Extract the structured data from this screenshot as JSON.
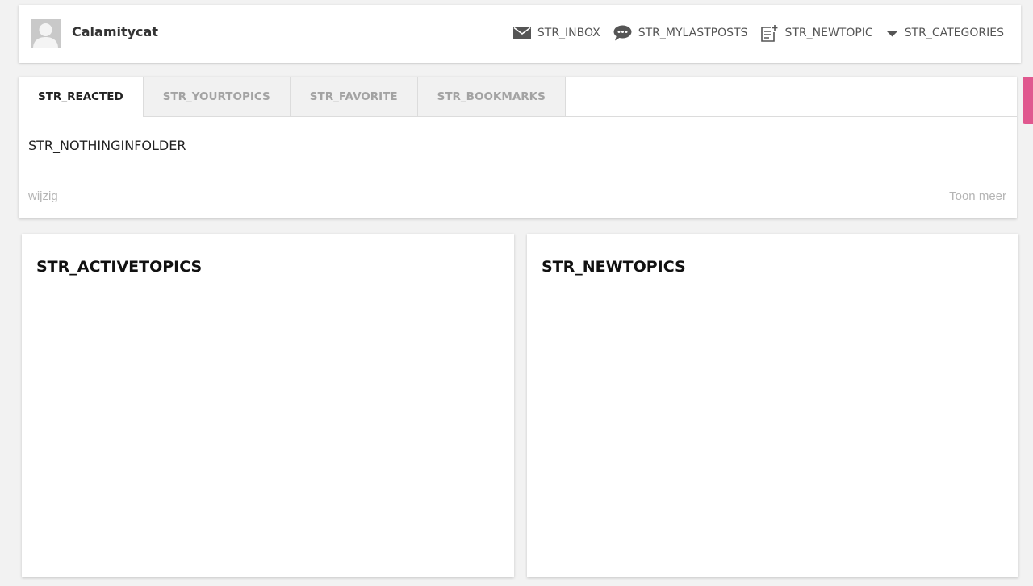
{
  "user": {
    "name": "Calamitycat"
  },
  "nav": {
    "inbox": "STR_INBOX",
    "mylastposts": "STR_MYLASTPOSTS",
    "newtopic": "STR_NEWTOPIC",
    "categories": "STR_CATEGORIES"
  },
  "tabs": [
    {
      "label": "STR_REACTED",
      "active": true
    },
    {
      "label": "STR_YOURTOPICS",
      "active": false
    },
    {
      "label": "STR_FAVORITE",
      "active": false
    },
    {
      "label": "STR_BOOKMARKS",
      "active": false
    }
  ],
  "folder": {
    "empty_message": "STR_NOTHINGINFOLDER",
    "edit_link": "wijzig",
    "more_link": "Toon meer"
  },
  "panels": {
    "active_title": "STR_ACTIVETOPICS",
    "new_title": "STR_NEWTOPICS"
  },
  "colors": {
    "background": "#f2f2f2",
    "accent_pink": "#e0588f",
    "icon_gray": "#555555"
  },
  "icons": {
    "inbox": "envelope-icon",
    "mylastposts": "speech-bubble-icon",
    "newtopic": "new-document-icon",
    "categories": "caret-down-icon"
  }
}
